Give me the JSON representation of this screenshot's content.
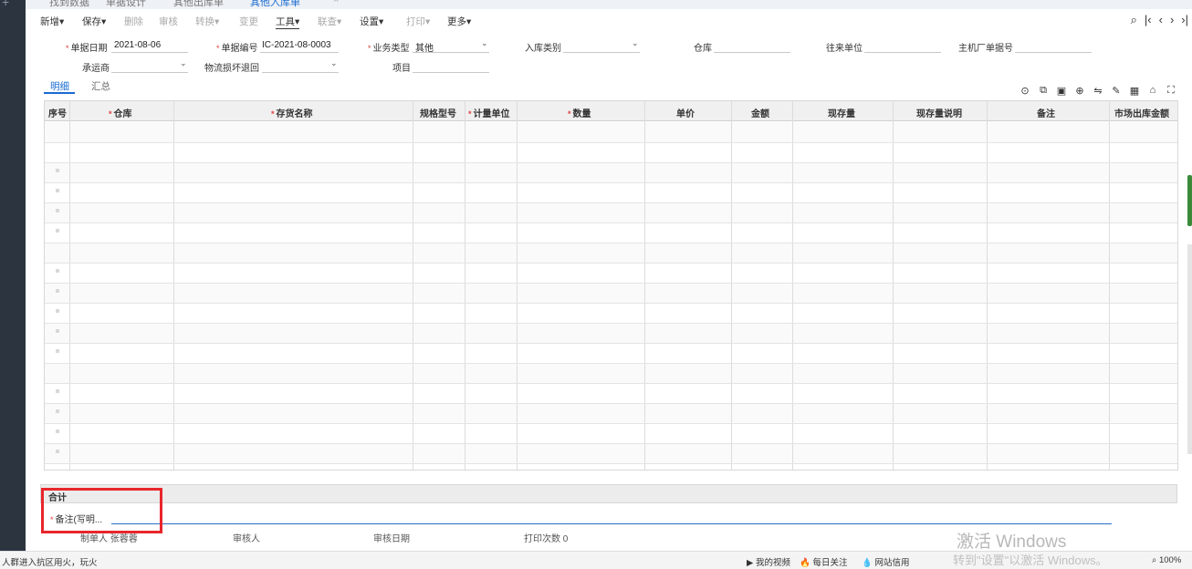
{
  "tabs": [
    "找到数据",
    "单据设计",
    "其他出库单",
    "其他入库单"
  ],
  "tab_close": "×",
  "toolbar": {
    "new": "新增▾",
    "save": "保存▾",
    "delete": "删除",
    "audit": "审核",
    "convert": "转换▾",
    "change": "变更",
    "tools": "工具▾",
    "link": "联查▾",
    "settings": "设置▾",
    "print": "打印▾",
    "more": "更多▾"
  },
  "nav_icons": {
    "search": "⌕",
    "first": "|‹",
    "prev": "‹",
    "next": "›",
    "last": "›|"
  },
  "form": {
    "date_label": "单据日期",
    "date_value": "2021-08-06",
    "number_label": "单据编号",
    "number_value": "IC-2021-08-0003",
    "biz_type_label": "业务类型",
    "biz_type_value": "其他",
    "in_type_label": "入库类别",
    "warehouse_label": "仓库",
    "partner_label": "往来单位",
    "oem_no_label": "主机厂单据号",
    "carrier_label": "承运商",
    "logistics_label": "物流损坏退回",
    "project_label": "项目",
    "required_mark": "*",
    "dropdown_arrow": "⌄"
  },
  "subtabs": {
    "detail": "明细",
    "summary": "汇总"
  },
  "grid_icons": [
    "⊙",
    "⧉",
    "▣",
    "⊕",
    "⇋",
    "✎",
    "▦",
    "⌂",
    "⛶"
  ],
  "grid": {
    "columns": [
      {
        "label": "序号",
        "required": false
      },
      {
        "label": "仓库",
        "required": true
      },
      {
        "label": "存货名称",
        "required": true
      },
      {
        "label": "规格型号",
        "required": false
      },
      {
        "label": "计量单位",
        "required": true
      },
      {
        "label": "数量",
        "required": true
      },
      {
        "label": "单价",
        "required": false
      },
      {
        "label": "金额",
        "required": false
      },
      {
        "label": "现存量",
        "required": false
      },
      {
        "label": "现存量说明",
        "required": false
      },
      {
        "label": "备注",
        "required": false
      },
      {
        "label": "市场出库金额",
        "required": false
      }
    ]
  },
  "total_label": "合计",
  "remark_label": "备注(写明...",
  "footer": {
    "maker": "制单人 张蓉蓉",
    "auditor": "审核人",
    "audit_date": "审核日期",
    "print_count": "打印次数 0"
  },
  "watermark": "激活 Windows",
  "watermark2": "转到\"设置\"以激活 Windows。",
  "statusbar": {
    "left": "人群进入抗区用火，玩火",
    "my_video": "我的视频",
    "daily": "每日关注",
    "web": "网站信用",
    "zoom": "100%"
  }
}
